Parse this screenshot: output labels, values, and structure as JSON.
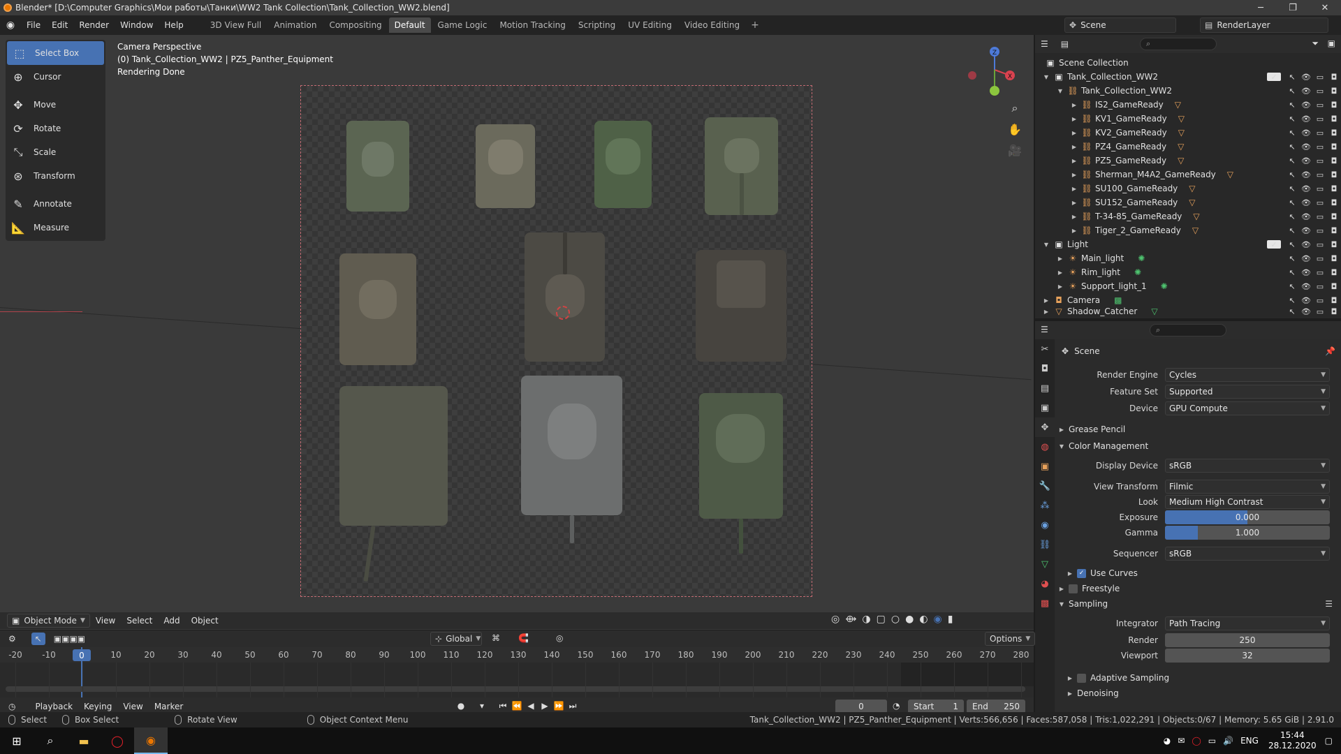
{
  "window": {
    "title": "Blender* [D:\\Computer Graphics\\Мои работы\\Танки\\WW2 Tank Collection\\Tank_Collection_WW2.blend]"
  },
  "menu": [
    "File",
    "Edit",
    "Render",
    "Window",
    "Help"
  ],
  "workspaces": [
    "3D View Full",
    "Animation",
    "Compositing",
    "Default",
    "Game Logic",
    "Motion Tracking",
    "Scripting",
    "UV Editing",
    "Video Editing"
  ],
  "active_workspace": "Default",
  "scene_name": "Scene",
  "view_layer": "RenderLayer",
  "tools": [
    "Select Box",
    "Cursor",
    "Move",
    "Rotate",
    "Scale",
    "Transform",
    "Annotate",
    "Measure"
  ],
  "viewport": {
    "info_line1": "Camera Perspective",
    "info_line2": "(0) Tank_Collection_WW2 | PZ5_Panther_Equipment",
    "info_line3": "Rendering Done",
    "mode": "Object Mode",
    "header_menus": [
      "View",
      "Select",
      "Add",
      "Object"
    ],
    "orientation": "Global",
    "options_label": "Options"
  },
  "timeline": {
    "menus": [
      "Playback",
      "Keying",
      "View",
      "Marker"
    ],
    "ruler_ticks": [
      "-20",
      "-10",
      "0",
      "10",
      "20",
      "30",
      "40",
      "50",
      "60",
      "70",
      "80",
      "90",
      "100",
      "110",
      "120",
      "130",
      "140",
      "150",
      "160",
      "170",
      "180",
      "190",
      "200",
      "210",
      "220",
      "230",
      "240",
      "250",
      "260",
      "270",
      "280"
    ],
    "current_frame": "0",
    "current_frame_field": "0",
    "start_label": "Start",
    "start_value": "1",
    "end_label": "End",
    "end_value": "250"
  },
  "statusbar": {
    "select": "Select",
    "box_select": "Box Select",
    "rotate_view": "Rotate View",
    "context_menu": "Object Context Menu",
    "stats": "Tank_Collection_WW2 | PZ5_Panther_Equipment | Verts:566,656 | Faces:587,058 | Tris:1,022,291 | Objects:0/67 | Memory: 5.65 GiB | 2.91.0"
  },
  "taskbar": {
    "lang": "ENG",
    "time": "15:44",
    "date": "28.12.2020"
  },
  "outliner": {
    "root": "Scene Collection",
    "collection": "Tank_Collection_WW2",
    "sub_collection": "Tank_Collection_WW2",
    "items": [
      "IS2_GameReady",
      "KV1_GameReady",
      "KV2_GameReady",
      "PZ4_GameReady",
      "PZ5_GameReady",
      "Sherman_M4A2_GameReady",
      "SU100_GameReady",
      "SU152_GameReady",
      "T-34-85_GameReady",
      "Tiger_2_GameReady"
    ],
    "light_collection": "Light",
    "lights": [
      "Main_light",
      "Rim_light",
      "Support_light_1"
    ],
    "camera": "Camera",
    "shadow": "Shadow_Catcher"
  },
  "properties": {
    "context": "Scene",
    "render_engine_label": "Render Engine",
    "render_engine": "Cycles",
    "feature_set_label": "Feature Set",
    "feature_set": "Supported",
    "device_label": "Device",
    "device": "GPU Compute",
    "grease_pencil": "Grease Pencil",
    "color_management": "Color Management",
    "display_device_label": "Display Device",
    "display_device": "sRGB",
    "view_transform_label": "View Transform",
    "view_transform": "Filmic",
    "look_label": "Look",
    "look": "Medium High Contrast",
    "exposure_label": "Exposure",
    "exposure": "0.000",
    "exposure_fill": 0.5,
    "gamma_label": "Gamma",
    "gamma": "1.000",
    "gamma_fill": 0.2,
    "sequencer_label": "Sequencer",
    "sequencer": "sRGB",
    "use_curves": "Use Curves",
    "freestyle": "Freestyle",
    "sampling": "Sampling",
    "integrator_label": "Integrator",
    "integrator": "Path Tracing",
    "render_label": "Render",
    "render_samples": "250",
    "viewport_label": "Viewport",
    "viewport_samples": "32",
    "adaptive_sampling": "Adaptive Sampling",
    "denoising": "Denoising"
  }
}
